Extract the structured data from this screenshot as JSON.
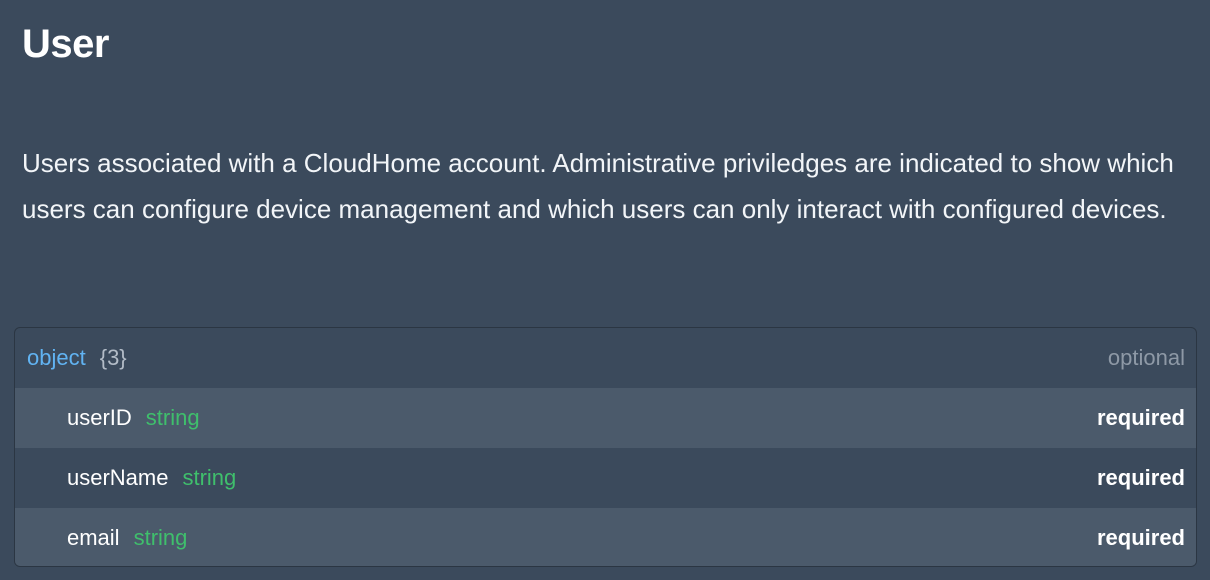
{
  "page": {
    "title": "User",
    "description": "Users associated with a CloudHome account. Administrative priviledges are indicated to show which users can configure device management and which users can only interact with configured devices."
  },
  "schema": {
    "type": "object",
    "count": "{3}",
    "status": "optional",
    "properties": [
      {
        "name": "userID",
        "type": "string",
        "status": "required"
      },
      {
        "name": "userName",
        "type": "string",
        "status": "required"
      },
      {
        "name": "email",
        "type": "string",
        "status": "required"
      }
    ]
  },
  "colors": {
    "background": "#3b4a5c",
    "alt_row": "#4b5a6b",
    "type_keyword": "#61b3f2",
    "property_type": "#3fbf6c",
    "muted": "#8e99a6"
  }
}
